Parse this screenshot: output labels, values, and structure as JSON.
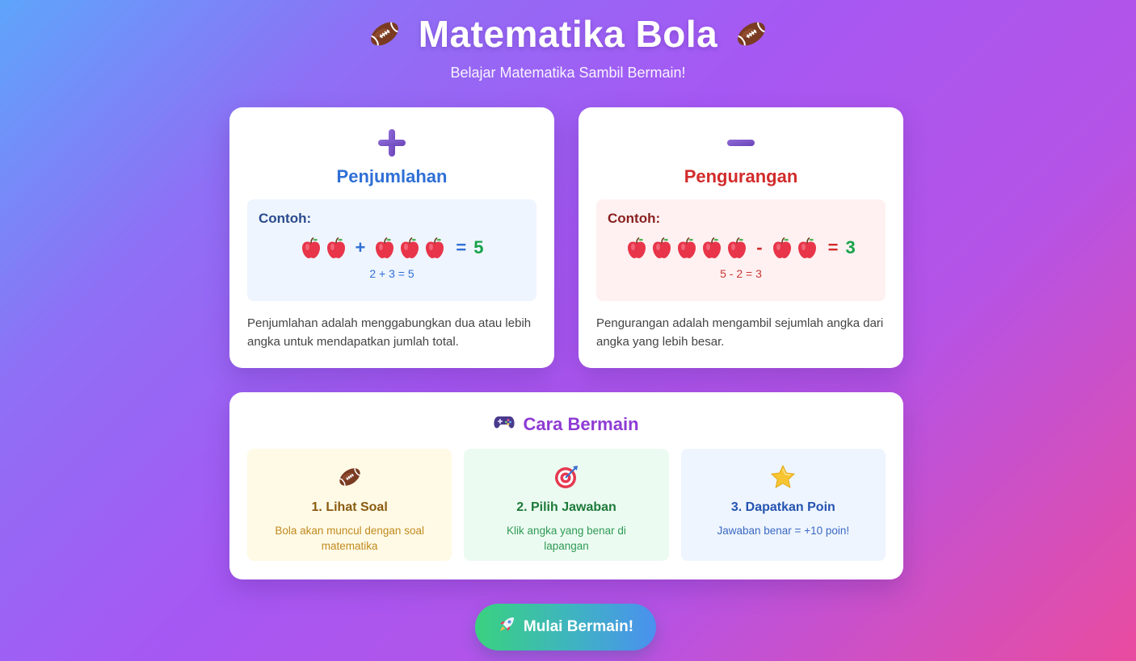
{
  "header": {
    "title": "Matematika Bola",
    "subtitle": "Belajar Matematika Sambil Bermain!",
    "icon": "football-icon"
  },
  "cards": {
    "addition": {
      "sign": "+",
      "title": "Penjumlahan",
      "example_label": "Contoh:",
      "left_count": 2,
      "operator": "+",
      "right_count": 3,
      "equals": "=",
      "result": "5",
      "formula": "2 + 3 = 5",
      "description": "Penjumlahan adalah menggabungkan dua atau lebih angka untuk mendapatkan jumlah total.",
      "icon": "apple-icon"
    },
    "subtraction": {
      "sign": "−",
      "title": "Pengurangan",
      "example_label": "Contoh:",
      "left_count": 5,
      "operator": "-",
      "right_count": 2,
      "equals": "=",
      "result": "3",
      "formula": "5 - 2 = 3",
      "description": "Pengurangan adalah mengambil sejumlah angka dari angka yang lebih besar.",
      "icon": "apple-icon"
    }
  },
  "howto": {
    "title": "Cara Bermain",
    "icon": "gamepad-icon",
    "steps": [
      {
        "title": "1. Lihat Soal",
        "desc": "Bola akan muncul dengan soal matematika",
        "icon": "football-icon"
      },
      {
        "title": "2. Pilih Jawaban",
        "desc": "Klik angka yang benar di lapangan",
        "icon": "target-icon"
      },
      {
        "title": "3. Dapatkan Poin",
        "desc": "Jawaban benar = +10 poin!",
        "icon": "star-icon"
      }
    ]
  },
  "start_button": {
    "label": "Mulai Bermain!",
    "icon": "rocket-icon"
  },
  "colors": {
    "addition": "#2f6fd6",
    "subtraction": "#d22b2b",
    "result": "#17a34a",
    "howto_title": "#8e3bd4",
    "sign": "#7a52c9"
  }
}
